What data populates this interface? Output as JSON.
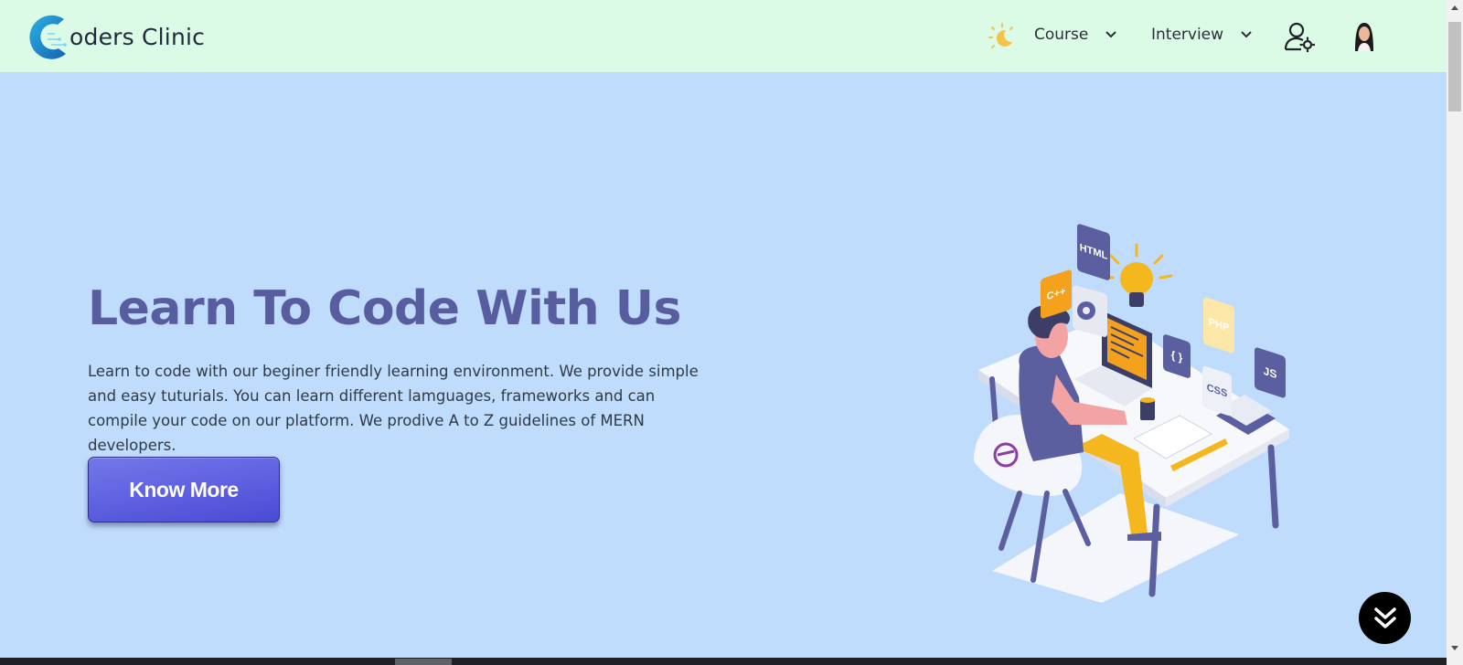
{
  "navbar": {
    "brand": "oders Clinic",
    "theme_icon": "sun-moon-icon",
    "items": [
      {
        "label": "Course",
        "icon": "chevron-down-icon"
      },
      {
        "label": "Interview",
        "icon": "chevron-down-icon"
      }
    ],
    "user_settings_icon": "user-gear-icon",
    "avatar_icon": "profile-avatar"
  },
  "hero": {
    "title": "Learn To Code With Us",
    "description": "Learn to code with our beginer friendly learning environment. We provide simple and easy tuturials. You can learn different lamguages, frameworks and can compile your code on our platform. We prodive A to Z guidelines of MERN developers.",
    "button_label": "Know More"
  },
  "illustration": {
    "badges": [
      "HTML",
      "C++",
      "PHP",
      "{ }",
      "CSS",
      "JS"
    ]
  },
  "scroll_button_icon": "double-chevron-down-icon",
  "colors": {
    "navbar_bg": "#dcfbe7",
    "hero_bg": "#bfdcfd",
    "title": "#585d9f",
    "button": "#5d5fe0"
  }
}
